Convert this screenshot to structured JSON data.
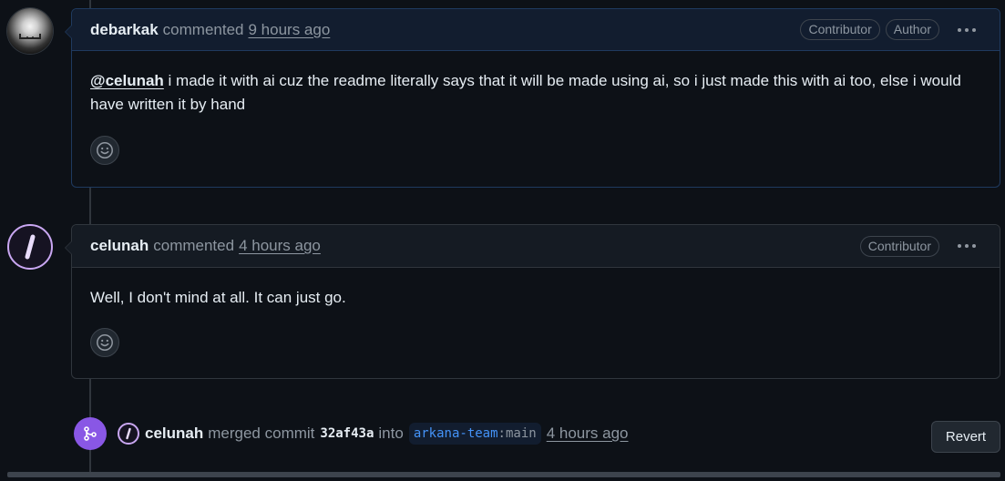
{
  "comments": [
    {
      "author": "debarkak",
      "action": "commented",
      "time": "9 hours ago",
      "badges": [
        "Contributor",
        "Author"
      ],
      "mention": "@celunah",
      "body": " i made it with ai cuz the readme literally says that it will be made using ai, so i just made this with ai too, else i would have written it by hand"
    },
    {
      "author": "celunah",
      "action": "commented",
      "time": "4 hours ago",
      "badges": [
        "Contributor"
      ],
      "body": "Well, I don't mind at all. It can just go."
    }
  ],
  "merge_event": {
    "author": "celunah",
    "action": "merged commit",
    "commit_sha": "32af43a",
    "into_label": "into",
    "repo": "arkana-team",
    "separator": ":",
    "branch": "main",
    "time": "4 hours ago",
    "revert_label": "Revert"
  },
  "colors": {
    "background": "#0d1117",
    "merge_purple": "#8957e5",
    "link_blue": "#4493f8",
    "avatar_ring": "#c9a7f2"
  },
  "icons": [
    "smiley-icon",
    "kebab-menu-icon",
    "git-merge-icon"
  ]
}
